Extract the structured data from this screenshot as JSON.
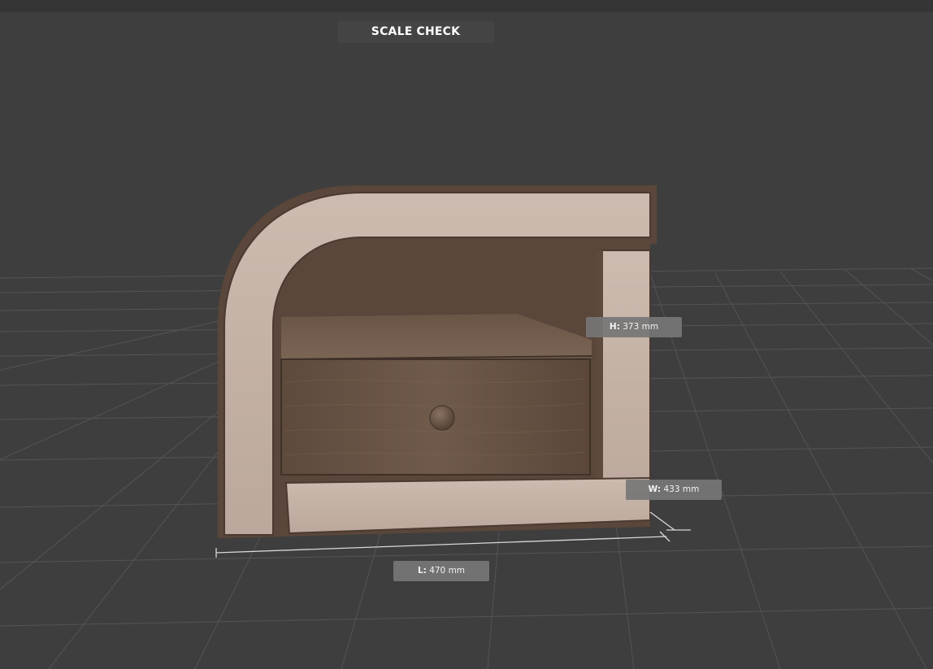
{
  "header": {
    "title": "SCALE CHECK"
  },
  "dimensions": {
    "height": {
      "key": "H:",
      "value": "373 mm"
    },
    "width": {
      "key": "W:",
      "value": "433 mm"
    },
    "length": {
      "key": "L:",
      "value": "470 mm"
    }
  },
  "colors": {
    "background": "#3e3e3e",
    "grid_line": "#5a5a5a",
    "upholstery": "#c4b1a6",
    "wood": "#6b5648",
    "frame": "#5a463a",
    "label_bg": "#767676",
    "text": "#ffffff"
  }
}
